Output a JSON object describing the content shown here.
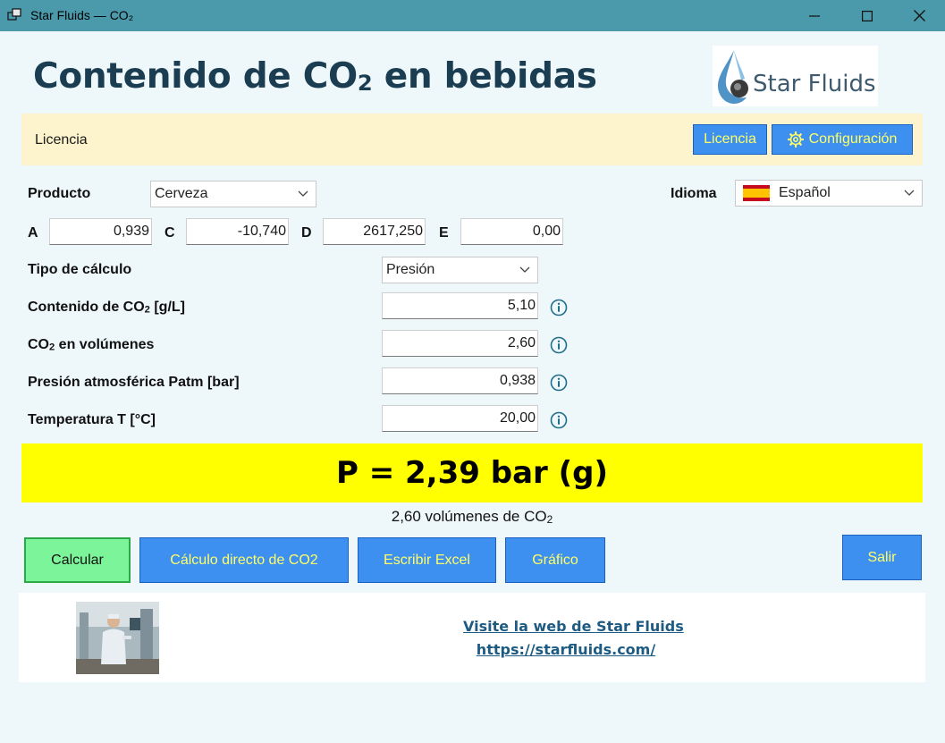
{
  "window": {
    "title": "Star Fluids — CO₂",
    "minimize_label": "Minimize",
    "maximize_label": "Maximize",
    "close_label": "Close"
  },
  "header": {
    "title_prefix": "Contenido de CO",
    "title_sub": "2",
    "title_suffix": " en bebidas",
    "logo_text": "Star Fluids"
  },
  "license_bar": {
    "label": "Licencia",
    "license_button": "Licencia",
    "config_button": "Configuración"
  },
  "form": {
    "product_label": "Producto",
    "product_value": "Cerveza",
    "language_label": "Idioma",
    "language_value": "Español",
    "coefficients": [
      {
        "label": "A",
        "value": "0,939"
      },
      {
        "label": "C",
        "value": "-10,740"
      },
      {
        "label": "D",
        "value": "2617,250"
      },
      {
        "label": "E",
        "value": "0,00"
      }
    ],
    "calc_type_label": "Tipo de cálculo",
    "calc_type_value": "Presión",
    "fields": [
      {
        "label_prefix": "Contenido de CO",
        "label_sub": "2",
        "label_suffix": " [g/L]",
        "value": "5,10"
      },
      {
        "label_prefix": "CO",
        "label_sub": "2",
        "label_suffix": " en volúmenes",
        "value": "2,60"
      },
      {
        "label_prefix": "Presión atmosférica Patm [bar]",
        "label_sub": "",
        "label_suffix": "",
        "value": "0,938"
      },
      {
        "label_prefix": "Temperatura T [°C]",
        "label_sub": "",
        "label_suffix": "",
        "value": "20,00"
      }
    ]
  },
  "result": {
    "main": "P = 2,39 bar (g)",
    "secondary_prefix": "2,60 volúmenes de CO",
    "secondary_sub": "2"
  },
  "actions": {
    "calculate": "Calcular",
    "direct_calc": "Cálculo directo de CO2",
    "excel": "Escribir Excel",
    "graph": "Gráfico",
    "exit": "Salir"
  },
  "footer": {
    "link_text": "Visite la web de Star Fluids",
    "url_text": "https://starfluids.com/"
  },
  "colors": {
    "titlebar": "#4a9aab",
    "background": "#eef7fa",
    "title_text": "#1b3d52",
    "license_bar": "#fdf4cd",
    "button": "#3d8ff0",
    "button_text": "#ffff66",
    "calc_button": "#7cf59a",
    "result_banner": "#ffff00",
    "link": "#1e5b82",
    "info_icon": "#1f6e8c"
  }
}
